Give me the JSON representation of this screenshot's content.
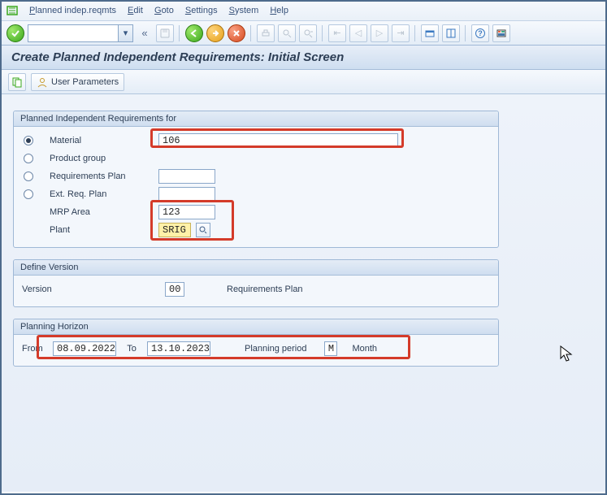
{
  "menu": {
    "items": [
      "Planned indep.reqmts",
      "Edit",
      "Goto",
      "Settings",
      "System",
      "Help"
    ]
  },
  "toolbar": {
    "command_value": "",
    "ok_tip": "Enter"
  },
  "title": "Create Planned Independent Requirements: Initial Screen",
  "subtoolbar": {
    "user_params": "User Parameters"
  },
  "group_pir": {
    "title": "Planned Independent Requirements for",
    "material_label": "Material",
    "material_value": "106",
    "product_group_label": "Product group",
    "product_group_value": "",
    "req_plan_label": "Requirements Plan",
    "req_plan_value": "",
    "ext_req_plan_label": "Ext. Req. Plan",
    "ext_req_plan_value": "",
    "mrp_area_label": "MRP Area",
    "mrp_area_value": "123",
    "plant_label": "Plant",
    "plant_value": "SRIG"
  },
  "group_version": {
    "title": "Define Version",
    "version_label": "Version",
    "version_value": "00",
    "req_plan_label": "Requirements Plan"
  },
  "group_horizon": {
    "title": "Planning Horizon",
    "from_label": "From",
    "from_value": "08.09.2022",
    "to_label": "To",
    "to_value": "13.10.2023",
    "period_label": "Planning period",
    "period_code": "M",
    "period_text": "Month"
  }
}
